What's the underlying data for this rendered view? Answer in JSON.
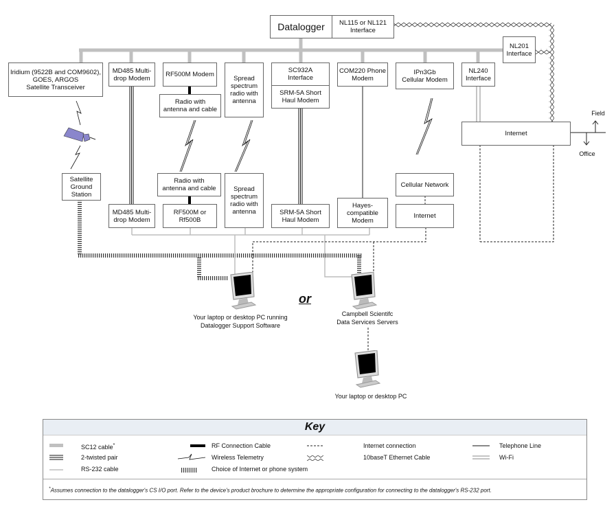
{
  "nodes": {
    "datalogger": "Datalogger",
    "nl115": "NL115 or NL121\nInterface",
    "nl201": "NL201\nInterface",
    "iridium": "Iridium (9522B and COM9602),\nGOES, ARGOS\nSatellite Transceiver",
    "md485_top": "MD485 Multi-\ndrop Modem",
    "rf500m": "RF500M Modem",
    "radio_top": "Radio with\nantenna and cable",
    "spread_top": "Spread\nspectrum\nradio with\nantenna",
    "sc932a": "SC932A\nInterface",
    "srm5a_top": "SRM-5A Short\nHaul Modem",
    "com220": "COM220 Phone\nModem",
    "ipn3gb": "IPn3Gb\nCellular Modem",
    "nl240": "NL240\nInterface",
    "internet_main": "Internet",
    "field": "Field",
    "office": "Office",
    "sat_ground": "Satellite\nGround\nStation",
    "md485_bottom": "MD485 Multi-\ndrop Modem",
    "radio_bottom": "Radio with\nantenna and cable",
    "rf500b": "RF500M or\nRf500B",
    "spread_bottom": "Spread\nspectrum\nradio with\nantenna",
    "srm5a_bottom": "SRM-5A Short\nHaul Modem",
    "hayes": "Hayes-\ncompatible\nModem",
    "cellular_network": "Cellular Network",
    "internet_small": "Internet"
  },
  "computers": {
    "pc_software": "Your laptop or desktop PC running\nDatalogger Support Software",
    "or": "or",
    "servers": "Campbell Scientifc\nData Services Servers",
    "pc_plain": "Your laptop or desktop PC"
  },
  "key": {
    "title": "Key",
    "items": [
      {
        "label": "SC12 cable",
        "mark": "*"
      },
      {
        "label": "2-twisted pair"
      },
      {
        "label": "RS-232 cable"
      },
      {
        "label": "RF Connection Cable"
      },
      {
        "label": "Wireless Telemetry"
      },
      {
        "label": "Choice of Internet or phone system"
      },
      {
        "label": "Internet connection"
      },
      {
        "label": "10baseT Ethernet Cable"
      },
      {
        "label": "Telephone Line"
      },
      {
        "label": "Wi-Fi"
      }
    ],
    "footnote_mark": "*",
    "footnote": "Assumes connection to the datalogger's CS I/O port.  Refer to the device's product brochure to determine the appropriate configuration for connecting to the datalogger's RS-232 port."
  },
  "colors": {
    "sc12": "#c0c0c0",
    "rs232": "#bdbdbd",
    "satellite": "#8a86cc",
    "key_header": "#e9eef4"
  }
}
